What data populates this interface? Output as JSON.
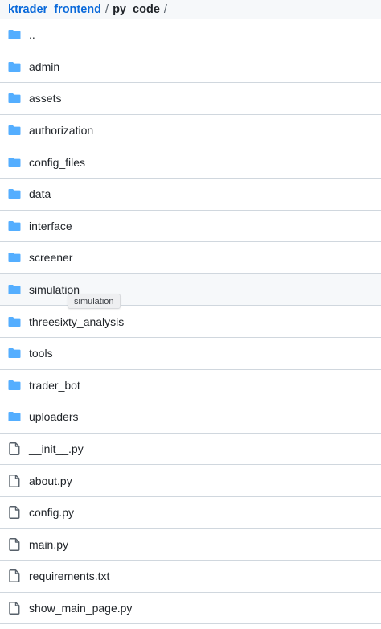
{
  "breadcrumb": {
    "repo": "ktrader_frontend",
    "separator": "/",
    "current": "py_code",
    "trailing": "/"
  },
  "colors": {
    "link": "#0969da",
    "folder_icon": "#54aeff",
    "file_icon": "#57606a",
    "border": "#d0d7de",
    "hover_row": "#f6f8fa"
  },
  "items": [
    {
      "name": "..",
      "type": "folder",
      "icon": "folder-icon"
    },
    {
      "name": "admin",
      "type": "folder",
      "icon": "folder-icon"
    },
    {
      "name": "assets",
      "type": "folder",
      "icon": "folder-icon"
    },
    {
      "name": "authorization",
      "type": "folder",
      "icon": "folder-icon"
    },
    {
      "name": "config_files",
      "type": "folder",
      "icon": "folder-icon"
    },
    {
      "name": "data",
      "type": "folder",
      "icon": "folder-icon"
    },
    {
      "name": "interface",
      "type": "folder",
      "icon": "folder-icon"
    },
    {
      "name": "screener",
      "type": "folder",
      "icon": "folder-icon"
    },
    {
      "name": "simulation",
      "type": "folder",
      "icon": "folder-icon",
      "hovered": true
    },
    {
      "name": "threesixty_analysis",
      "type": "folder",
      "icon": "folder-icon"
    },
    {
      "name": "tools",
      "type": "folder",
      "icon": "folder-icon"
    },
    {
      "name": "trader_bot",
      "type": "folder",
      "icon": "folder-icon"
    },
    {
      "name": "uploaders",
      "type": "folder",
      "icon": "folder-icon"
    },
    {
      "name": "__init__.py",
      "type": "file",
      "icon": "file-icon"
    },
    {
      "name": "about.py",
      "type": "file",
      "icon": "file-icon"
    },
    {
      "name": "config.py",
      "type": "file",
      "icon": "file-icon"
    },
    {
      "name": "main.py",
      "type": "file",
      "icon": "file-icon"
    },
    {
      "name": "requirements.txt",
      "type": "file",
      "icon": "file-icon"
    },
    {
      "name": "show_main_page.py",
      "type": "file",
      "icon": "file-icon"
    }
  ],
  "tooltip": {
    "text": "simulation"
  }
}
